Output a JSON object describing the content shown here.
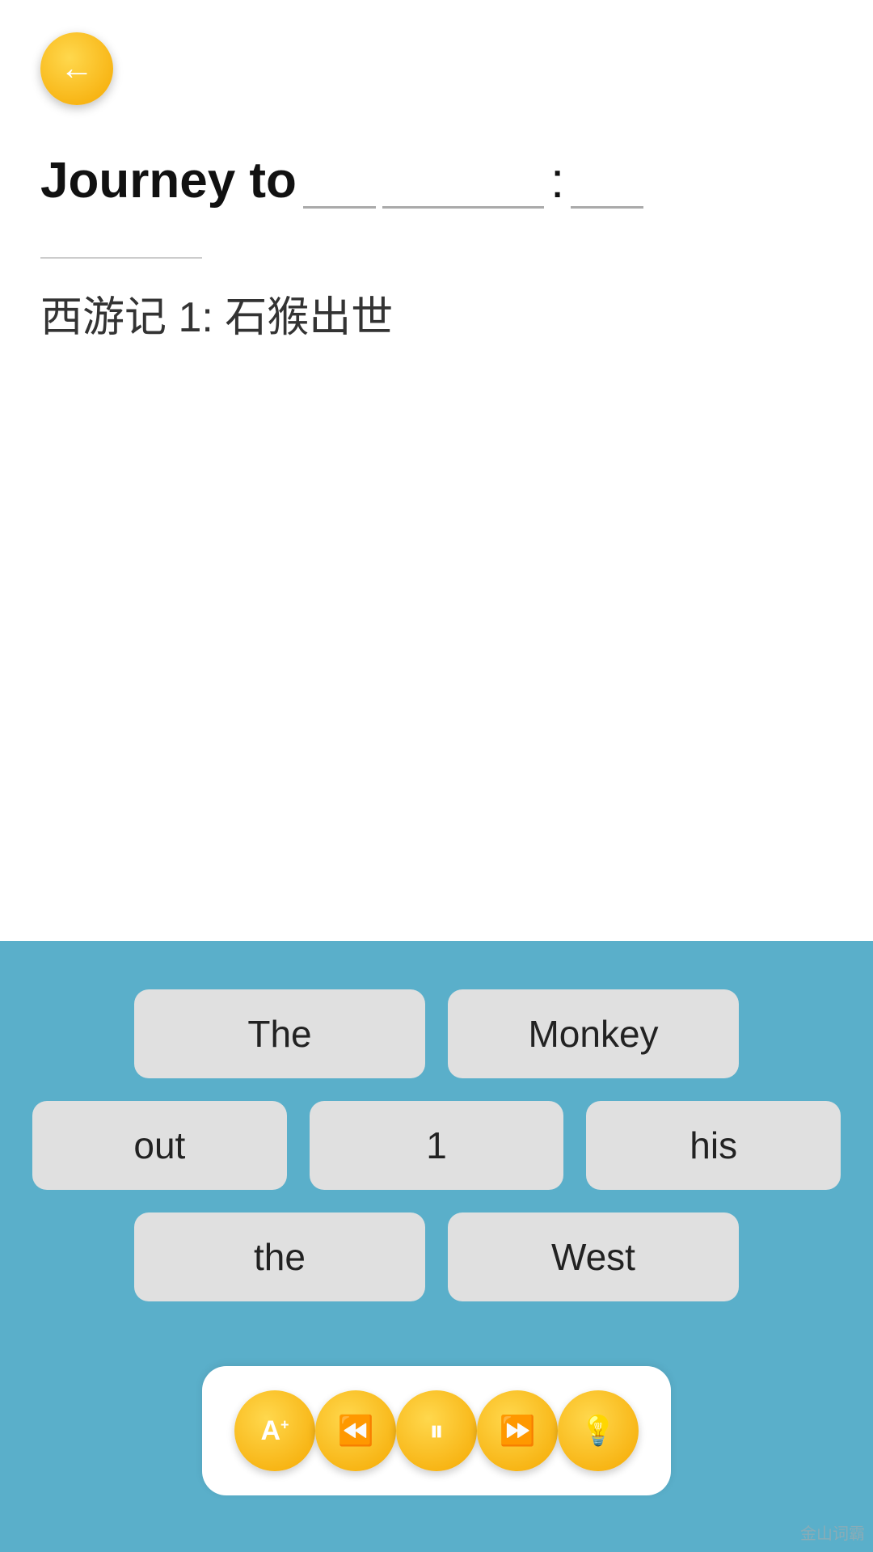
{
  "header": {
    "back_label": "←"
  },
  "title": {
    "prefix": "Journey to",
    "blank1": "",
    "blank2": "",
    "colon": ":",
    "blank3": ""
  },
  "subtitle": "西游记 1: 石猴出世",
  "words": {
    "row1": [
      "The",
      "Monkey"
    ],
    "row2": [
      "out",
      "1",
      "his"
    ],
    "row3": [
      "the",
      "West"
    ]
  },
  "toolbar": {
    "flashcard_label": "A+",
    "rewind_label": "⏮",
    "pause_label": "⏸",
    "forward_label": "⏭",
    "lightbulb_label": "💡"
  },
  "watermark": "金山词霸"
}
